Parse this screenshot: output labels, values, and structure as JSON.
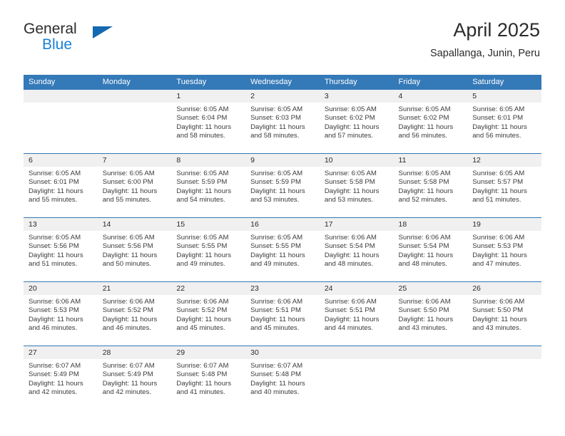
{
  "brand": {
    "line1": "General",
    "line2": "Blue",
    "flag_icon": "triangle-flag-icon",
    "accent_color": "#1b7fd4"
  },
  "header": {
    "title": "April 2025",
    "subtitle": "Sapallanga, Junin, Peru"
  },
  "theme": {
    "header_blue": "#3479b8",
    "daynum_band": "#f0f0f0",
    "text": "#2b2b2b"
  },
  "weekday_headers": [
    "Sunday",
    "Monday",
    "Tuesday",
    "Wednesday",
    "Thursday",
    "Friday",
    "Saturday"
  ],
  "labels": {
    "sunrise_prefix": "Sunrise:",
    "sunset_prefix": "Sunset:",
    "daylight_prefix": "Daylight:"
  },
  "weeks": [
    [
      {
        "day": "",
        "sunrise": "",
        "sunset": "",
        "daylight_l1": "",
        "daylight_l2": "",
        "empty": true
      },
      {
        "day": "",
        "sunrise": "",
        "sunset": "",
        "daylight_l1": "",
        "daylight_l2": "",
        "empty": true
      },
      {
        "day": "1",
        "sunrise": "Sunrise: 6:05 AM",
        "sunset": "Sunset: 6:04 PM",
        "daylight_l1": "Daylight: 11 hours",
        "daylight_l2": "and 58 minutes.",
        "empty": false
      },
      {
        "day": "2",
        "sunrise": "Sunrise: 6:05 AM",
        "sunset": "Sunset: 6:03 PM",
        "daylight_l1": "Daylight: 11 hours",
        "daylight_l2": "and 58 minutes.",
        "empty": false
      },
      {
        "day": "3",
        "sunrise": "Sunrise: 6:05 AM",
        "sunset": "Sunset: 6:02 PM",
        "daylight_l1": "Daylight: 11 hours",
        "daylight_l2": "and 57 minutes.",
        "empty": false
      },
      {
        "day": "4",
        "sunrise": "Sunrise: 6:05 AM",
        "sunset": "Sunset: 6:02 PM",
        "daylight_l1": "Daylight: 11 hours",
        "daylight_l2": "and 56 minutes.",
        "empty": false
      },
      {
        "day": "5",
        "sunrise": "Sunrise: 6:05 AM",
        "sunset": "Sunset: 6:01 PM",
        "daylight_l1": "Daylight: 11 hours",
        "daylight_l2": "and 56 minutes.",
        "empty": false
      }
    ],
    [
      {
        "day": "6",
        "sunrise": "Sunrise: 6:05 AM",
        "sunset": "Sunset: 6:01 PM",
        "daylight_l1": "Daylight: 11 hours",
        "daylight_l2": "and 55 minutes.",
        "empty": false
      },
      {
        "day": "7",
        "sunrise": "Sunrise: 6:05 AM",
        "sunset": "Sunset: 6:00 PM",
        "daylight_l1": "Daylight: 11 hours",
        "daylight_l2": "and 55 minutes.",
        "empty": false
      },
      {
        "day": "8",
        "sunrise": "Sunrise: 6:05 AM",
        "sunset": "Sunset: 5:59 PM",
        "daylight_l1": "Daylight: 11 hours",
        "daylight_l2": "and 54 minutes.",
        "empty": false
      },
      {
        "day": "9",
        "sunrise": "Sunrise: 6:05 AM",
        "sunset": "Sunset: 5:59 PM",
        "daylight_l1": "Daylight: 11 hours",
        "daylight_l2": "and 53 minutes.",
        "empty": false
      },
      {
        "day": "10",
        "sunrise": "Sunrise: 6:05 AM",
        "sunset": "Sunset: 5:58 PM",
        "daylight_l1": "Daylight: 11 hours",
        "daylight_l2": "and 53 minutes.",
        "empty": false
      },
      {
        "day": "11",
        "sunrise": "Sunrise: 6:05 AM",
        "sunset": "Sunset: 5:58 PM",
        "daylight_l1": "Daylight: 11 hours",
        "daylight_l2": "and 52 minutes.",
        "empty": false
      },
      {
        "day": "12",
        "sunrise": "Sunrise: 6:05 AM",
        "sunset": "Sunset: 5:57 PM",
        "daylight_l1": "Daylight: 11 hours",
        "daylight_l2": "and 51 minutes.",
        "empty": false
      }
    ],
    [
      {
        "day": "13",
        "sunrise": "Sunrise: 6:05 AM",
        "sunset": "Sunset: 5:56 PM",
        "daylight_l1": "Daylight: 11 hours",
        "daylight_l2": "and 51 minutes.",
        "empty": false
      },
      {
        "day": "14",
        "sunrise": "Sunrise: 6:05 AM",
        "sunset": "Sunset: 5:56 PM",
        "daylight_l1": "Daylight: 11 hours",
        "daylight_l2": "and 50 minutes.",
        "empty": false
      },
      {
        "day": "15",
        "sunrise": "Sunrise: 6:05 AM",
        "sunset": "Sunset: 5:55 PM",
        "daylight_l1": "Daylight: 11 hours",
        "daylight_l2": "and 49 minutes.",
        "empty": false
      },
      {
        "day": "16",
        "sunrise": "Sunrise: 6:05 AM",
        "sunset": "Sunset: 5:55 PM",
        "daylight_l1": "Daylight: 11 hours",
        "daylight_l2": "and 49 minutes.",
        "empty": false
      },
      {
        "day": "17",
        "sunrise": "Sunrise: 6:06 AM",
        "sunset": "Sunset: 5:54 PM",
        "daylight_l1": "Daylight: 11 hours",
        "daylight_l2": "and 48 minutes.",
        "empty": false
      },
      {
        "day": "18",
        "sunrise": "Sunrise: 6:06 AM",
        "sunset": "Sunset: 5:54 PM",
        "daylight_l1": "Daylight: 11 hours",
        "daylight_l2": "and 48 minutes.",
        "empty": false
      },
      {
        "day": "19",
        "sunrise": "Sunrise: 6:06 AM",
        "sunset": "Sunset: 5:53 PM",
        "daylight_l1": "Daylight: 11 hours",
        "daylight_l2": "and 47 minutes.",
        "empty": false
      }
    ],
    [
      {
        "day": "20",
        "sunrise": "Sunrise: 6:06 AM",
        "sunset": "Sunset: 5:53 PM",
        "daylight_l1": "Daylight: 11 hours",
        "daylight_l2": "and 46 minutes.",
        "empty": false
      },
      {
        "day": "21",
        "sunrise": "Sunrise: 6:06 AM",
        "sunset": "Sunset: 5:52 PM",
        "daylight_l1": "Daylight: 11 hours",
        "daylight_l2": "and 46 minutes.",
        "empty": false
      },
      {
        "day": "22",
        "sunrise": "Sunrise: 6:06 AM",
        "sunset": "Sunset: 5:52 PM",
        "daylight_l1": "Daylight: 11 hours",
        "daylight_l2": "and 45 minutes.",
        "empty": false
      },
      {
        "day": "23",
        "sunrise": "Sunrise: 6:06 AM",
        "sunset": "Sunset: 5:51 PM",
        "daylight_l1": "Daylight: 11 hours",
        "daylight_l2": "and 45 minutes.",
        "empty": false
      },
      {
        "day": "24",
        "sunrise": "Sunrise: 6:06 AM",
        "sunset": "Sunset: 5:51 PM",
        "daylight_l1": "Daylight: 11 hours",
        "daylight_l2": "and 44 minutes.",
        "empty": false
      },
      {
        "day": "25",
        "sunrise": "Sunrise: 6:06 AM",
        "sunset": "Sunset: 5:50 PM",
        "daylight_l1": "Daylight: 11 hours",
        "daylight_l2": "and 43 minutes.",
        "empty": false
      },
      {
        "day": "26",
        "sunrise": "Sunrise: 6:06 AM",
        "sunset": "Sunset: 5:50 PM",
        "daylight_l1": "Daylight: 11 hours",
        "daylight_l2": "and 43 minutes.",
        "empty": false
      }
    ],
    [
      {
        "day": "27",
        "sunrise": "Sunrise: 6:07 AM",
        "sunset": "Sunset: 5:49 PM",
        "daylight_l1": "Daylight: 11 hours",
        "daylight_l2": "and 42 minutes.",
        "empty": false
      },
      {
        "day": "28",
        "sunrise": "Sunrise: 6:07 AM",
        "sunset": "Sunset: 5:49 PM",
        "daylight_l1": "Daylight: 11 hours",
        "daylight_l2": "and 42 minutes.",
        "empty": false
      },
      {
        "day": "29",
        "sunrise": "Sunrise: 6:07 AM",
        "sunset": "Sunset: 5:48 PM",
        "daylight_l1": "Daylight: 11 hours",
        "daylight_l2": "and 41 minutes.",
        "empty": false
      },
      {
        "day": "30",
        "sunrise": "Sunrise: 6:07 AM",
        "sunset": "Sunset: 5:48 PM",
        "daylight_l1": "Daylight: 11 hours",
        "daylight_l2": "and 40 minutes.",
        "empty": false
      },
      {
        "day": "",
        "sunrise": "",
        "sunset": "",
        "daylight_l1": "",
        "daylight_l2": "",
        "empty": true
      },
      {
        "day": "",
        "sunrise": "",
        "sunset": "",
        "daylight_l1": "",
        "daylight_l2": "",
        "empty": true
      },
      {
        "day": "",
        "sunrise": "",
        "sunset": "",
        "daylight_l1": "",
        "daylight_l2": "",
        "empty": true
      }
    ]
  ]
}
